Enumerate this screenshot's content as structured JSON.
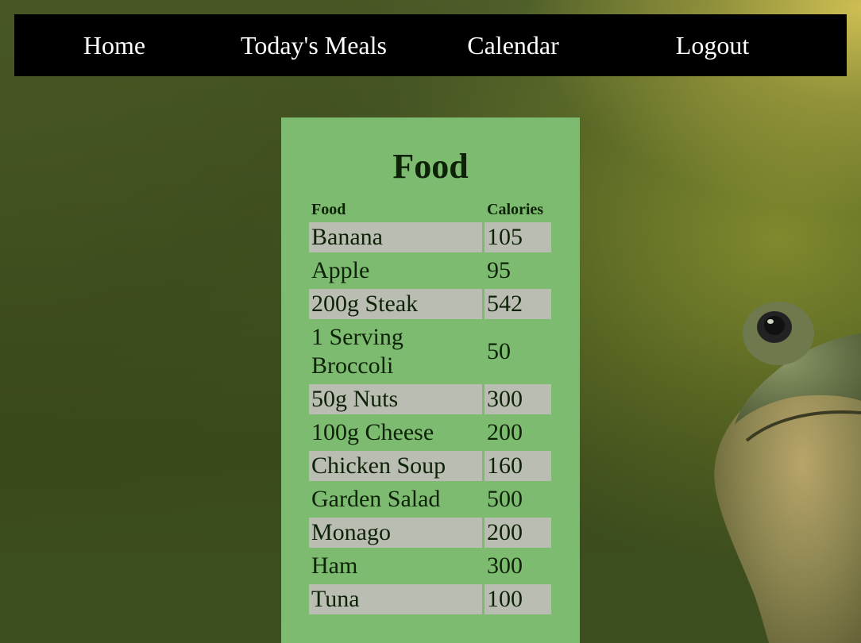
{
  "nav": {
    "items": [
      {
        "label": "Home"
      },
      {
        "label": "Today's Meals"
      },
      {
        "label": "Calendar"
      },
      {
        "label": "Logout"
      }
    ]
  },
  "food": {
    "title": "Food",
    "columns": [
      "Food",
      "Calories"
    ],
    "rows": [
      {
        "food": "Banana",
        "calories": "105"
      },
      {
        "food": "Apple",
        "calories": "95"
      },
      {
        "food": "200g Steak",
        "calories": "542"
      },
      {
        "food": "1 Serving Broccoli",
        "calories": "50"
      },
      {
        "food": "50g Nuts",
        "calories": "300"
      },
      {
        "food": "100g Cheese",
        "calories": "200"
      },
      {
        "food": "Chicken Soup",
        "calories": "160"
      },
      {
        "food": "Garden Salad",
        "calories": "500"
      },
      {
        "food": "Monago",
        "calories": "200"
      },
      {
        "food": "Ham",
        "calories": "300"
      },
      {
        "food": "Tuna",
        "calories": "100"
      }
    ]
  },
  "colors": {
    "nav_background": "#000000",
    "panel_background": "#7dbb70",
    "row_shade": "#babdb1"
  },
  "background": {
    "icon": "frog-photo"
  }
}
